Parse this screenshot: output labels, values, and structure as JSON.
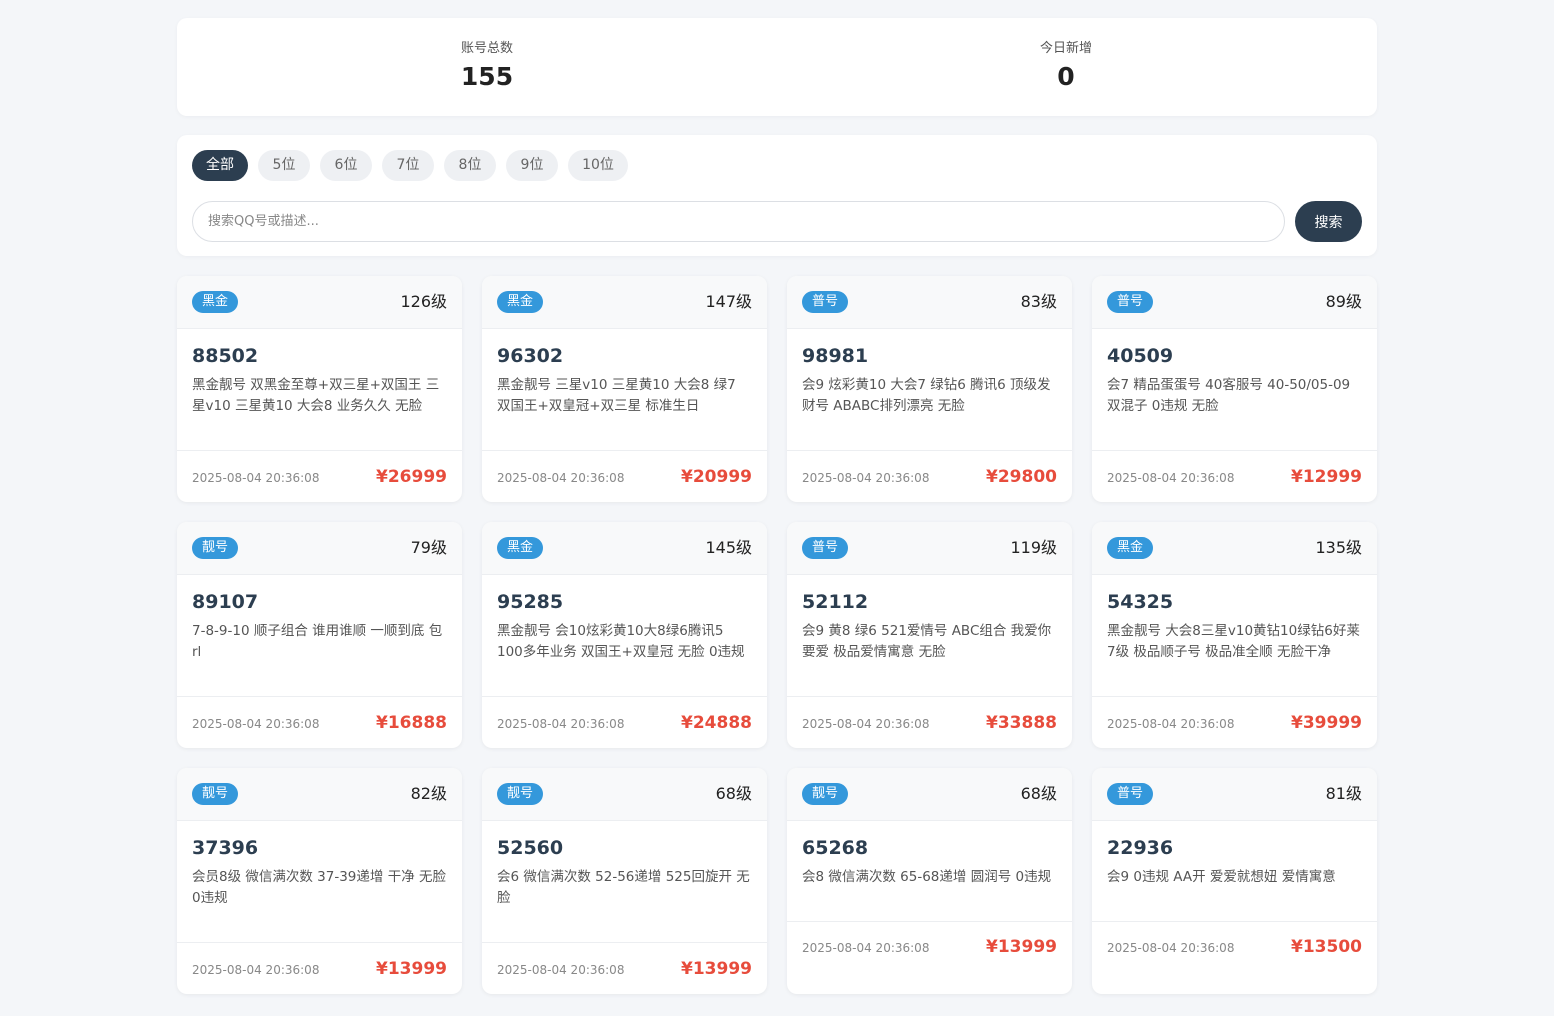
{
  "stats": {
    "total_label": "账号总数",
    "total_value": "155",
    "today_label": "今日新增",
    "today_value": "0"
  },
  "filter": {
    "tabs": [
      "全部",
      "5位",
      "6位",
      "7位",
      "8位",
      "9位",
      "10位"
    ],
    "active_tab": "全部",
    "search_placeholder": "搜索QQ号或描述...",
    "search_value": "",
    "search_button": "搜索"
  },
  "cards": [
    {
      "type": "黑金",
      "level": "126级",
      "qq": "88502",
      "desc": "黑金靓号 双黑金至尊+双三星+双国王 三星v10 三星黄10 大会8 业务久久 无脸",
      "time": "2025-08-04 20:36:08",
      "price": "¥26999"
    },
    {
      "type": "黑金",
      "level": "147级",
      "qq": "96302",
      "desc": "黑金靓号 三星v10 三星黄10 大会8 绿7 双国王+双皇冠+双三星 标准生日",
      "time": "2025-08-04 20:36:08",
      "price": "¥20999"
    },
    {
      "type": "普号",
      "level": "83级",
      "qq": "98981",
      "desc": "会9 炫彩黄10 大会7 绿钻6 腾讯6 顶级发财号 ABABC排列漂亮 无脸",
      "time": "2025-08-04 20:36:08",
      "price": "¥29800"
    },
    {
      "type": "普号",
      "level": "89级",
      "qq": "40509",
      "desc": "会7 精品蛋蛋号 40客服号 40-50/05-09 双混子 0违规 无脸",
      "time": "2025-08-04 20:36:08",
      "price": "¥12999"
    },
    {
      "type": "靓号",
      "level": "79级",
      "qq": "89107",
      "desc": "7-8-9-10 顺子组合 谁用谁顺 一顺到底 包rl",
      "time": "2025-08-04 20:36:08",
      "price": "¥16888"
    },
    {
      "type": "黑金",
      "level": "145级",
      "qq": "95285",
      "desc": "黑金靓号 会10炫彩黄10大8绿6腾讯5 100多年业务 双国王+双皇冠 无脸 0违规",
      "time": "2025-08-04 20:36:08",
      "price": "¥24888"
    },
    {
      "type": "普号",
      "level": "119级",
      "qq": "52112",
      "desc": "会9 黄8 绿6 521爱情号 ABC组合 我爱你要爱 极品爱情寓意 无脸",
      "time": "2025-08-04 20:36:08",
      "price": "¥33888"
    },
    {
      "type": "黑金",
      "level": "135级",
      "qq": "54325",
      "desc": "黑金靓号 大会8三星v10黄钻10绿钻6好莱7级 极品顺子号 极品准全顺 无脸干净",
      "time": "2025-08-04 20:36:08",
      "price": "¥39999"
    },
    {
      "type": "靓号",
      "level": "82级",
      "qq": "37396",
      "desc": "会员8级 微信满次数 37-39递增 干净 无脸 0违规",
      "time": "2025-08-04 20:36:08",
      "price": "¥13999"
    },
    {
      "type": "靓号",
      "level": "68级",
      "qq": "52560",
      "desc": "会6 微信满次数 52-56递增 525回旋开 无脸",
      "time": "2025-08-04 20:36:08",
      "price": "¥13999"
    },
    {
      "type": "靓号",
      "level": "68级",
      "qq": "65268",
      "desc": "会8 微信满次数 65-68递增 圆润号 0违规",
      "time": "2025-08-04 20:36:08",
      "price": "¥13999"
    },
    {
      "type": "普号",
      "level": "81级",
      "qq": "22936",
      "desc": "会9 0违规 AA开 爱爱就想妞 爱情寓意",
      "time": "2025-08-04 20:36:08",
      "price": "¥13500"
    }
  ],
  "colors": {
    "primary": "#2c3e50",
    "badge": "#3498db",
    "price": "#e74c3c",
    "background": "#f4f6f9"
  }
}
